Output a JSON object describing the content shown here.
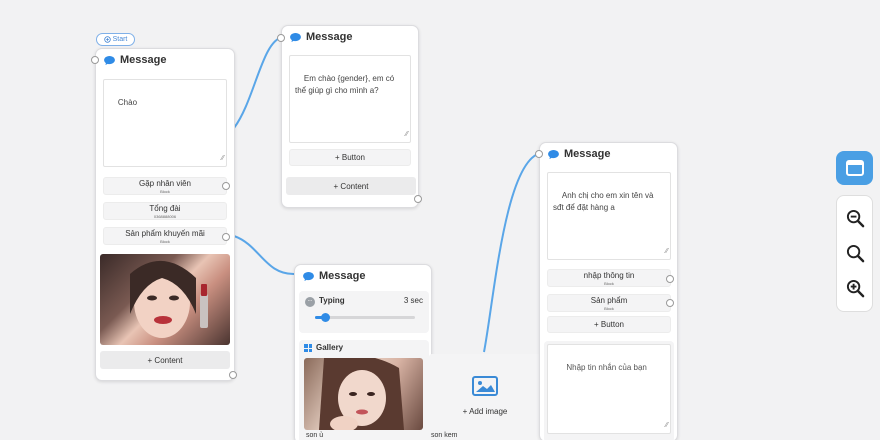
{
  "start_badge": {
    "label": "Start"
  },
  "node1": {
    "title": "Message",
    "text": "Chào",
    "buttons": [
      {
        "label": "Gặp nhân viên",
        "type": "Block"
      },
      {
        "label": "Tổng đài",
        "type": "0368888006"
      },
      {
        "label": "Sản phẩm khuyến mãi",
        "type": "Block"
      }
    ],
    "content_label": "+ Content"
  },
  "node2": {
    "title": "Message",
    "text": "Em chào {gender}, em có thể giúp gì cho mình a?",
    "button_label": "+ Button",
    "content_label": "+ Content"
  },
  "node3": {
    "title": "Message",
    "typing": {
      "label": "Typing",
      "value": "3 sec",
      "slider_fraction": 0.1
    },
    "gallery": {
      "label": "Gallery",
      "items": [
        {
          "caption": "son ủ"
        },
        {
          "caption": "son kem"
        }
      ],
      "add_label": "+ Add image"
    }
  },
  "node4": {
    "title": "Message",
    "text": "Anh chị cho em xin tên và sđt để đặt hàng a",
    "buttons": [
      {
        "label": "nhập thông tin",
        "type": "Block"
      },
      {
        "label": "Sản phẩm",
        "type": "Block"
      }
    ],
    "button_label": "+ Button",
    "input_placeholder": "Nhập tin nhắn của bạn"
  },
  "toolbar": {
    "icons": [
      "view-icon",
      "zoom-out-icon",
      "search-icon",
      "zoom-in-icon"
    ],
    "accent": "#4a9fe4"
  },
  "colors": {
    "edge": "#5aa6e8",
    "chat_icon": "#2f8be6"
  }
}
